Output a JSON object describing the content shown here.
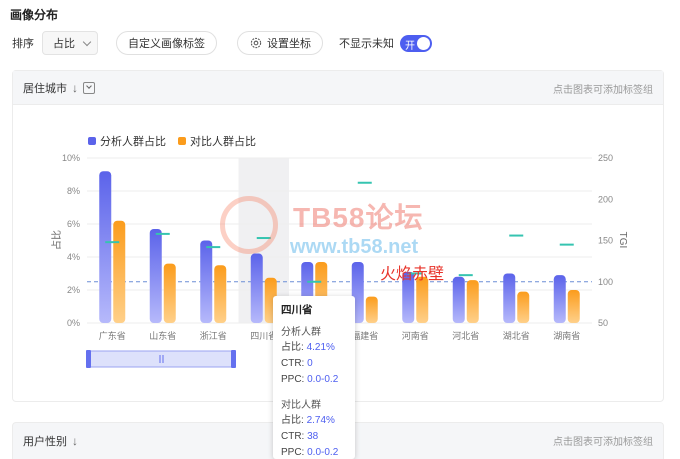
{
  "page": {
    "title": "画像分布"
  },
  "toolbar": {
    "sort_label": "排序",
    "sort_value": "占比",
    "custom_tag_label": "自定义画像标签",
    "axis_settings_label": "设置坐标",
    "hide_unknown_label": "不显示未知",
    "toggle_text": "开"
  },
  "panel_city": {
    "title": "居住城市",
    "hint": "点击图表可添加标签组"
  },
  "panel_gender": {
    "title": "用户性别",
    "hint": "点击图表可添加标签组"
  },
  "colors": {
    "series1": "#5b63ea",
    "series2": "#fb9c1c",
    "tgi": "#35c4b0",
    "accent": "#4d5ef0"
  },
  "chart_data": {
    "type": "bar",
    "categories": [
      "广东省",
      "山东省",
      "浙江省",
      "四川省",
      "江苏省",
      "福建省",
      "河南省",
      "河北省",
      "湖北省",
      "湖南省"
    ],
    "series": [
      {
        "name": "分析人群占比",
        "values": [
          9.2,
          5.7,
          5.0,
          4.21,
          3.7,
          3.7,
          3.1,
          2.8,
          3.0,
          2.9
        ]
      },
      {
        "name": "对比人群占比",
        "values": [
          6.2,
          3.6,
          3.5,
          2.74,
          3.7,
          1.6,
          2.8,
          2.6,
          1.9,
          2.0
        ]
      }
    ],
    "tgi": [
      148,
      158,
      142,
      153,
      100,
      220,
      110,
      108,
      156,
      145
    ],
    "y_left": {
      "label": "占比",
      "ticks": [
        "0%",
        "2%",
        "4%",
        "6%",
        "8%",
        "10%"
      ],
      "min": 0,
      "max": 10
    },
    "y_right": {
      "label": "TGI",
      "ticks": [
        "50",
        "100",
        "150",
        "200",
        "250"
      ],
      "min": 50,
      "max": 250
    },
    "reference_line": 100,
    "hover_category": "四川省",
    "legend": "top-left"
  },
  "tooltip": {
    "title": "四川省",
    "group1": {
      "name": "分析人群",
      "share_label": "占比:",
      "share": "4.21%",
      "ctr_label": "CTR:",
      "ctr": "0",
      "ppc_label": "PPC:",
      "ppc": "0.0-0.2"
    },
    "group2": {
      "name": "对比人群",
      "share_label": "占比:",
      "share": "2.74%",
      "ctr_label": "CTR:",
      "ctr": "38",
      "ppc_label": "PPC:",
      "ppc": "0.0-0.2"
    }
  },
  "watermark": {
    "brand": "TB58论坛",
    "url": "www.tb58.net",
    "author": "火焰赤壁"
  }
}
